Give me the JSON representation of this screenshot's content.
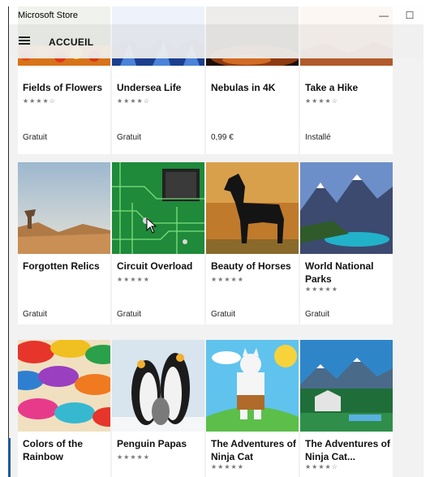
{
  "window": {
    "title": "Microsoft Store",
    "minimize_glyph": "—",
    "maximize_glyph": "☐"
  },
  "appbar": {
    "title": "ACCUEIL",
    "menu_icon": "hamburger-icon"
  },
  "rows": [
    {
      "items": [
        {
          "title": "Fields of Flowers",
          "rating": "★★★★☆",
          "price": "Gratuit"
        },
        {
          "title": "Undersea Life",
          "rating": "★★★★☆",
          "price": "Gratuit"
        },
        {
          "title": "Nebulas in 4K",
          "rating": "",
          "price": "0,99 €"
        },
        {
          "title": "Take a Hike",
          "rating": "★★★★☆",
          "price": "Installé"
        }
      ]
    },
    {
      "items": [
        {
          "title": "Forgotten Relics",
          "rating": "",
          "price": "Gratuit"
        },
        {
          "title": "Circuit Overload",
          "rating": "★★★★★",
          "price": "Gratuit"
        },
        {
          "title": "Beauty of Horses",
          "rating": "★★★★★",
          "price": "Gratuit"
        },
        {
          "title": "World National Parks",
          "rating": "★★★★★",
          "price": "Gratuit"
        }
      ]
    },
    {
      "items": [
        {
          "title": "Colors of the Rainbow",
          "rating": "",
          "price": ""
        },
        {
          "title": "Penguin Papas",
          "rating": "★★★★★",
          "price": ""
        },
        {
          "title": "The Adventures of Ninja Cat",
          "rating": "★★★★★",
          "price": ""
        },
        {
          "title": "The Adventures of Ninja Cat...",
          "rating": "★★★★☆",
          "price": ""
        }
      ]
    }
  ]
}
